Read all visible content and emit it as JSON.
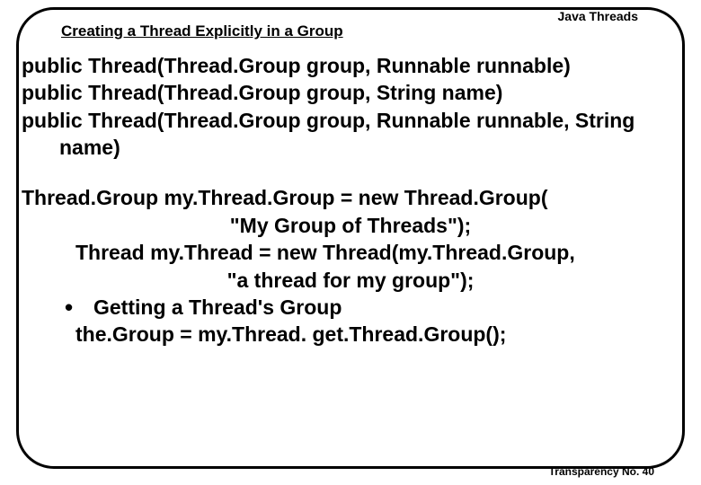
{
  "header": {
    "topic": "Java Threads",
    "title": "Creating a Thread Explicitly in a Group"
  },
  "body": {
    "sig1a": "public Thread(Thread.Group group, Runnable runnable)",
    "sig2": "public Thread(Thread.Group group, String name)",
    "sig3a": "public Thread(Thread.Group group, Runnable runnable, String name)",
    "ex1": "Thread.Group my.Thread.Group = new Thread.Group(",
    "ex1b": "\"My Group of Threads\");",
    "ex2": "Thread my.Thread = new Thread(my.Thread.Group,",
    "ex2b": "\"a thread for my group\");",
    "bullet": "Getting a Thread's Group",
    "ex3": "the.Group = my.Thread. get.Thread.Group();"
  },
  "footer": {
    "label": "Transparency No. 40"
  }
}
